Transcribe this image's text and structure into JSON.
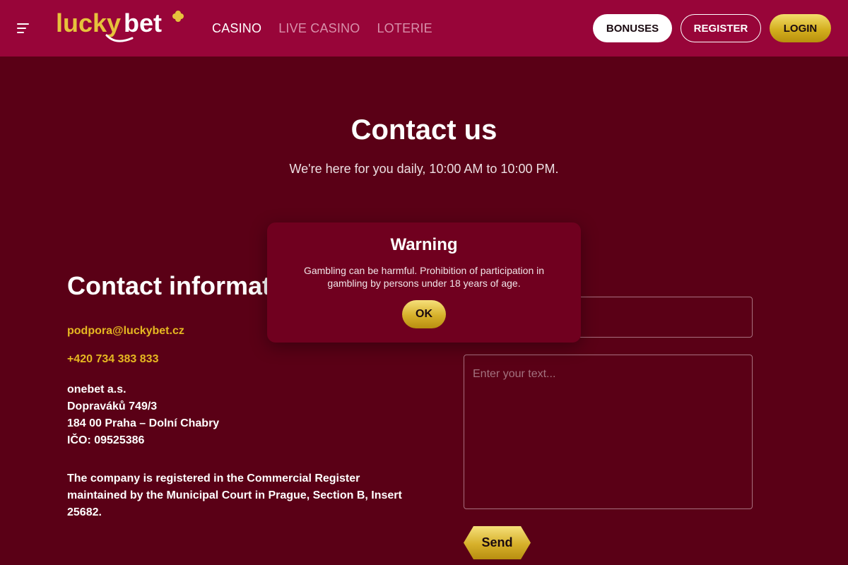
{
  "header": {
    "logo_text_lucky": "lucky",
    "logo_text_bet": "bet",
    "nav": [
      {
        "label": "CASINO"
      },
      {
        "label": "LIVE CASINO"
      },
      {
        "label": "LOTERIE"
      }
    ],
    "bonuses_label": "BONUSES",
    "register_label": "REGISTER",
    "login_label": "LOGIN"
  },
  "hero": {
    "title": "Contact us",
    "subtitle": "We're here for you daily, 10:00 AM to 10:00 PM."
  },
  "contact": {
    "title": "Contact information",
    "email": "podpora@luckybet.cz",
    "phone": "+420 734 383 833",
    "address": [
      "onebet a.s.",
      "Dopraváků 749/3",
      "184 00 Praha – Dolní Chabry",
      "IČO: 09525386"
    ],
    "registration": "The company is registered in the Commercial Register maintained by the Municipal Court in Prague, Section B, Insert 25682."
  },
  "form": {
    "subject_value": "",
    "message_placeholder": "Enter your text...",
    "send_label": "Send"
  },
  "modal": {
    "title": "Warning",
    "text": "Gambling can be harmful. Prohibition of participation in gambling by persons under 18 years of age.",
    "ok_label": "OK"
  },
  "colors": {
    "header_bg": "#980539",
    "page_bg": "#5a0016",
    "modal_bg": "#70001f",
    "accent_gold": "#e6b821"
  },
  "icons": {
    "menu": "hamburger-menu-icon",
    "logo_clover": "clover-icon"
  }
}
